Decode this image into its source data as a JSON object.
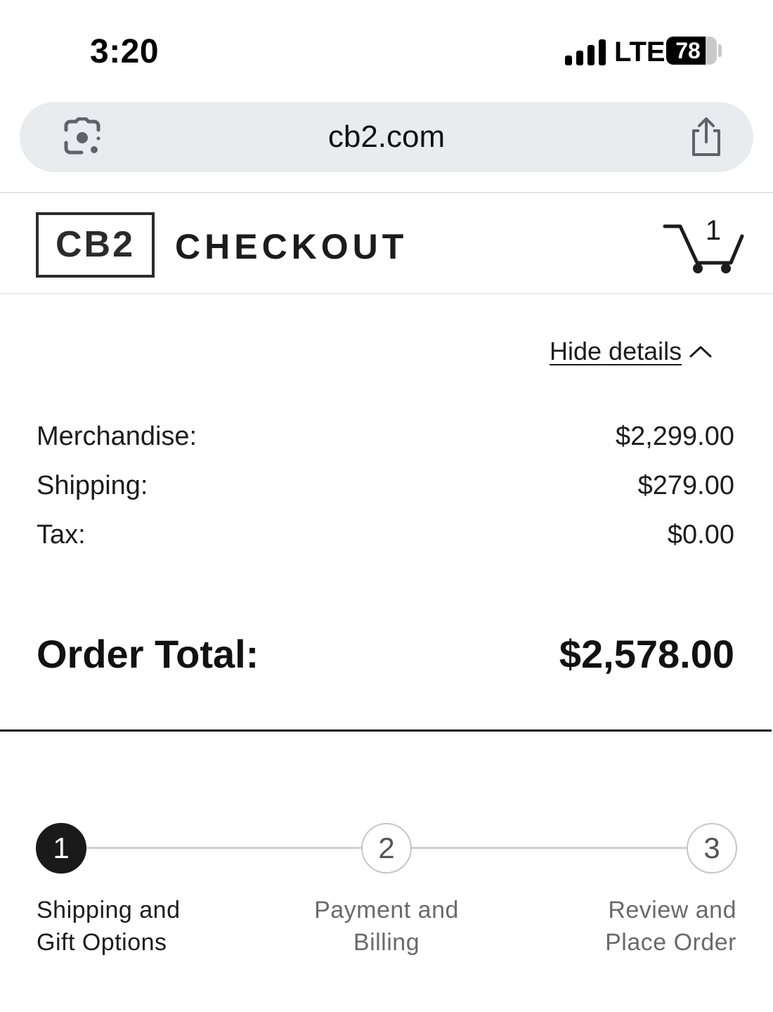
{
  "status_bar": {
    "time": "3:20",
    "network": "LTE",
    "battery_percent": "78",
    "battery_level": 0.78,
    "signal_bars": 4
  },
  "browser": {
    "url": "cb2.com",
    "lens_icon": "google-lens-icon",
    "share_icon": "share-icon"
  },
  "header": {
    "logo": "CB2",
    "title": "CHECKOUT",
    "cart_icon": "shopping-cart-icon",
    "cart_count": "1"
  },
  "summary": {
    "toggle_label": "Hide details",
    "toggle_icon": "chevron-up-icon",
    "merchandise": {
      "label": "Merchandise:",
      "value": "$2,299.00"
    },
    "shipping": {
      "label": "Shipping:",
      "value": "$279.00"
    },
    "tax": {
      "label": "Tax:",
      "value": "$0.00"
    },
    "total": {
      "label": "Order Total:",
      "value": "$2,578.00"
    }
  },
  "steps": [
    {
      "number": "1",
      "label_line1": "Shipping and",
      "label_line2": "Gift Options",
      "active": true
    },
    {
      "number": "2",
      "label_line1": "Payment and",
      "label_line2": "Billing",
      "active": false
    },
    {
      "number": "3",
      "label_line1": "Review and",
      "label_line2": "Place Order",
      "active": false
    }
  ],
  "colors": {
    "text": "#1c1c1c",
    "active_step": "#1a1a1a",
    "inactive_text": "#6a6a6a",
    "url_bar_bg": "#e8ecef"
  }
}
